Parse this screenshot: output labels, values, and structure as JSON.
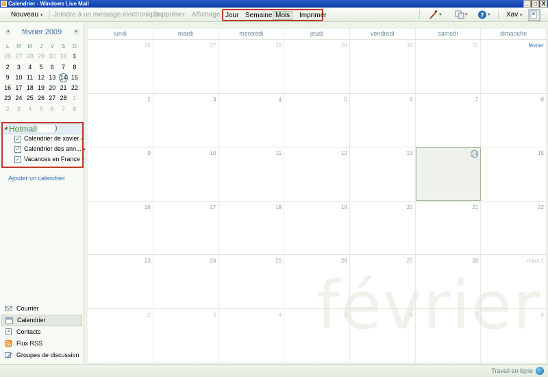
{
  "window": {
    "title": "Calendrier - Windows Live Mail",
    "buttons": [
      "_",
      "□",
      "X"
    ]
  },
  "toolbar": {
    "new_label": "Nouveau",
    "attach_label": "Joindre à un message électronique",
    "delete_label": "Supprimer",
    "display_label": "Affichage :",
    "view_buttons": [
      "Jour",
      "Semaine",
      "Mois",
      "Imprimer"
    ],
    "active_view": "Mois",
    "user_label": "Xav",
    "help_icon": "help-icon"
  },
  "mini_calendar": {
    "month": "février 2009",
    "prev": "◂",
    "next": "▸",
    "weekdays": [
      "L",
      "M",
      "M",
      "J",
      "V",
      "S",
      "D"
    ],
    "weeks": [
      [
        "26",
        "27",
        "28",
        "29",
        "30",
        "31",
        "1"
      ],
      [
        "2",
        "3",
        "4",
        "5",
        "6",
        "7",
        "8"
      ],
      [
        "9",
        "10",
        "11",
        "12",
        "13",
        "14",
        "15"
      ],
      [
        "16",
        "17",
        "18",
        "19",
        "20",
        "21",
        "22"
      ],
      [
        "23",
        "24",
        "25",
        "26",
        "27",
        "28",
        "1"
      ],
      [
        "2",
        "3",
        "4",
        "5",
        "6",
        "7",
        "8"
      ]
    ],
    "today": "14"
  },
  "calendars": {
    "account": "Hotmail",
    "account_suffix": ")",
    "items": [
      {
        "label": "Calendrier de xavier",
        "checked": true
      },
      {
        "label": "Calendrier des ann...",
        "checked": true
      },
      {
        "label": "Vacances en France",
        "checked": true
      }
    ],
    "add_label": "Ajouter un calendrier"
  },
  "nav": {
    "items": [
      "Courrier",
      "Calendrier",
      "Contacts",
      "Flux RSS",
      "Groupes de discussion"
    ],
    "active": "Calendrier"
  },
  "month_view": {
    "day_names": [
      "lundi",
      "mardi",
      "mercredi",
      "jeudi",
      "vendredi",
      "samedi",
      "dimanche"
    ],
    "weeks": [
      [
        "26",
        "27",
        "28",
        "29",
        "30",
        "31",
        "février"
      ],
      [
        "2",
        "3",
        "4",
        "5",
        "6",
        "7",
        "8"
      ],
      [
        "9",
        "10",
        "11",
        "12",
        "13",
        "14",
        "15"
      ],
      [
        "16",
        "17",
        "18",
        "19",
        "20",
        "21",
        "22"
      ],
      [
        "23",
        "24",
        "25",
        "26",
        "27",
        "28",
        "mars  1"
      ],
      [
        "2",
        "3",
        "4",
        "5",
        "6",
        "7",
        "8"
      ]
    ],
    "watermark": "février"
  },
  "status": {
    "text": "Travail en ligne"
  }
}
